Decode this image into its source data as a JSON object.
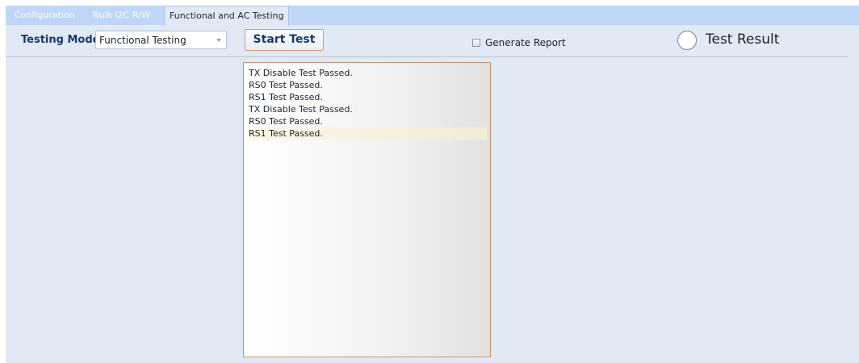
{
  "tabs": [
    {
      "label": "Configuration",
      "active": false
    },
    {
      "label": "Bulk I2C R/W",
      "active": false
    },
    {
      "label": "Functional and AC Testing",
      "active": true
    }
  ],
  "toolbar": {
    "testing_mode_label": "Testing Mode",
    "testing_mode_value": "Functional Testing",
    "start_button_label": "Start Test",
    "generate_report_label": "Generate Report",
    "generate_report_checked": false,
    "test_result_label": "Test Result"
  },
  "log": {
    "lines": [
      "TX Disable Test Passed.",
      "RS0 Test Passed.",
      "RS1 Test Passed.",
      "TX Disable Test Passed.",
      "RS0 Test Passed.",
      "RS1 Test Passed."
    ],
    "selected_index": 5
  },
  "colors": {
    "window_bg": "#e1e9f5",
    "tabstrip_bg": "#c0d6f7",
    "accent_text": "#1b3a6b",
    "log_border": "#c9936f"
  },
  "icons": {
    "dropdown": "chevron-down-icon",
    "result_indicator": "circle-indicator-icon",
    "checkbox": "checkbox-icon"
  }
}
